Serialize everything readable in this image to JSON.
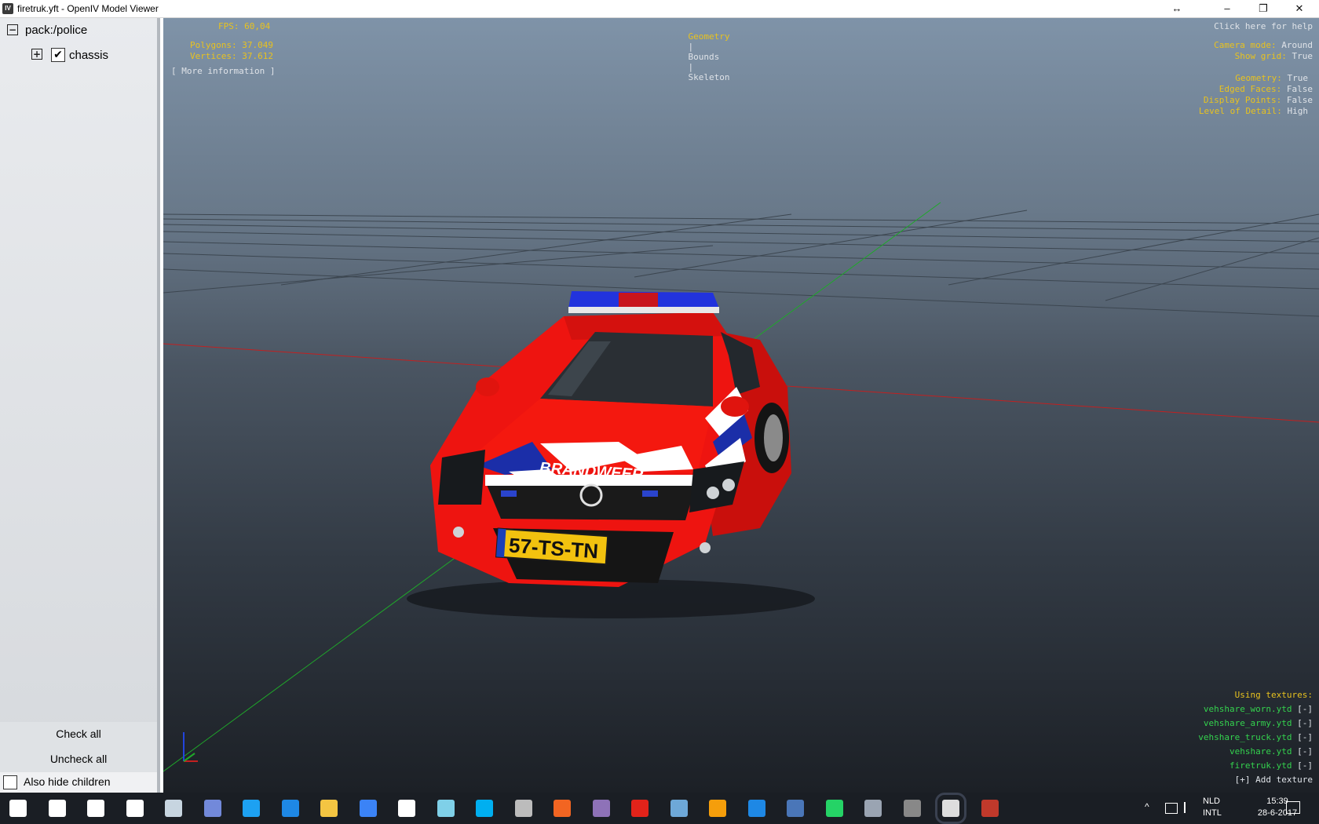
{
  "window": {
    "title": "firetruk.yft - OpenIV Model Viewer",
    "app_icon": "IV",
    "resize_glyph": "↔",
    "minimize": "–",
    "restore": "❐",
    "close": "✕"
  },
  "tree": {
    "root_toggle": "−",
    "root_label": "pack:/police",
    "child_toggle": "+",
    "child_check": "✔",
    "child_label": "chassis"
  },
  "controls": {
    "check_all": "Check all",
    "uncheck_all": "Uncheck all",
    "also_hide_children": "Also hide children"
  },
  "overlay": {
    "fps_label": "FPS:",
    "fps_value": "60,04",
    "polygons_label": "Polygons:",
    "polygons_value": "37.049",
    "vertices_label": "Vertices:",
    "vertices_value": "37.612",
    "more_info": "[ More information ]",
    "tabs": {
      "geometry": "Geometry",
      "sep": "|",
      "bounds": "Bounds",
      "skeleton": "Skeleton"
    },
    "help": "Click here for help",
    "settings": [
      {
        "label": "Camera mode:",
        "value": "Around"
      },
      {
        "label": "Show grid:",
        "value": "True"
      },
      {
        "label": "Geometry:",
        "value": "True"
      },
      {
        "label": "Edged Faces:",
        "value": "False"
      },
      {
        "label": "Display Points:",
        "value": "False"
      },
      {
        "label": "Level of Detail:",
        "value": "High"
      }
    ],
    "textures_header": "Using textures:",
    "textures": [
      {
        "name": "vehshare_worn.ytd",
        "remove": "[-]"
      },
      {
        "name": "vehshare_army.ytd",
        "remove": "[-]"
      },
      {
        "name": "vehshare_truck.ytd",
        "remove": "[-]"
      },
      {
        "name": "vehshare.ytd",
        "remove": "[-]"
      },
      {
        "name": "firetruk.ytd",
        "remove": "[-]"
      }
    ],
    "add_texture": "[+] Add texture"
  },
  "vehicle": {
    "livery_text": "BRANDWEER",
    "plate": "57-TS-TN",
    "body_color": "#ee1410",
    "stripe_blue": "#1b2ea8",
    "lightbar_blue": "#2233dd"
  },
  "taskbar": {
    "language": "NLD",
    "layout": "INTL",
    "time": "15:39",
    "date": "28-6-2017",
    "chevron": "^",
    "icons": [
      "windows-start-icon",
      "search-icon",
      "task-view-icon",
      "mail-icon",
      "steam-icon",
      "discord-icon",
      "twitter-icon",
      "edge-icon",
      "file-explorer-icon",
      "chrome-icon",
      "store-icon",
      "app-icon",
      "skype-icon",
      "obs-icon",
      "d-app-icon",
      "tor-icon",
      "roblox-icon",
      "dolphin-icon",
      "vlc-icon",
      "teamviewer-icon",
      "calculator-icon",
      "whatsapp-icon",
      "shield-icon",
      "gta-icon",
      "openiv-icon",
      "winrar-icon"
    ]
  },
  "colors": {
    "overlay_yellow": "#e8c21f",
    "overlay_white": "#dfe3e8",
    "overlay_green": "#34d24e"
  }
}
